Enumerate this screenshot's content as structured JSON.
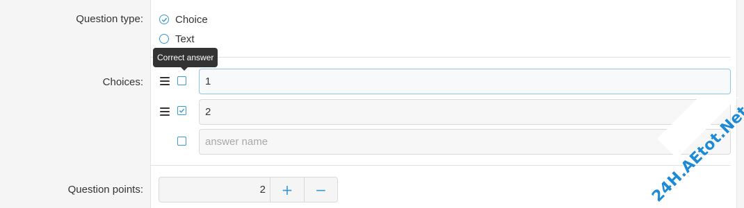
{
  "question_type": {
    "label": "Question type:",
    "options": [
      {
        "label": "Choice",
        "selected": true
      },
      {
        "label": "Text",
        "selected": false
      }
    ]
  },
  "choices": {
    "label": "Choices:",
    "tooltip": "Correct answer",
    "items": [
      {
        "value": "1",
        "correct": false
      },
      {
        "value": "2",
        "correct": true
      }
    ],
    "new_item_placeholder": "answer name"
  },
  "points": {
    "label": "Question points:",
    "value": "2",
    "plus": "+",
    "minus": "−"
  },
  "watermark": "24H.AEtot.Net",
  "colors": {
    "accent": "#3a9ad9",
    "tooltip_bg": "#333333",
    "watermark": "#1e8ad6"
  }
}
